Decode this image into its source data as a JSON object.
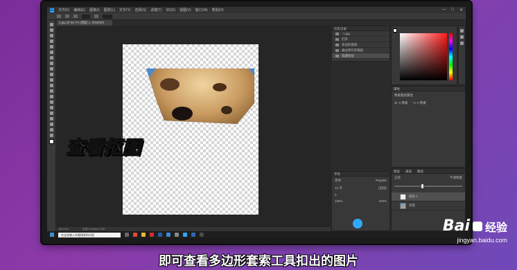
{
  "app": {
    "logo": "Ps",
    "menu": [
      "文件(F)",
      "编辑(E)",
      "图像(I)",
      "图层(L)",
      "文字(Y)",
      "选择(S)",
      "滤镜(T)",
      "3D(D)",
      "视图(V)",
      "窗口(W)",
      "帮助(H)"
    ],
    "window_controls": [
      "—",
      "□",
      "✕"
    ]
  },
  "document": {
    "tab_label": "1.jpg @ 66.7% (图层 1, RGB/8#)",
    "status_zoom": "66.67%",
    "status_info": "文档:1.59M/1.27M"
  },
  "panels": {
    "history": {
      "title": "历史记录",
      "snapshot": "1.jpg",
      "items": [
        "打开",
        "多边形套索",
        "通过拷贝的图层",
        "隐藏图层"
      ],
      "active_index": 3
    },
    "color": {
      "title": "颜色"
    },
    "properties": {
      "title": "属性",
      "row1": "像素图层属性",
      "w": "W: 0 像素",
      "h": "H: 0 像素"
    },
    "character": {
      "title": "字符",
      "font": "黑体",
      "style": "Regular",
      "size": "12 点",
      "leading": "(自动)",
      "tracking": "0",
      "scale1": "100%",
      "scale2": "100%"
    },
    "layers": {
      "title": "图层",
      "tabs": [
        "图层",
        "通道",
        "路径"
      ],
      "mode": "正常",
      "opacity_label": "不透明度",
      "rows": [
        {
          "name": "图层 1",
          "thumb": "checker",
          "active": true
        },
        {
          "name": "背景",
          "thumb": "photo",
          "active": false
        }
      ]
    }
  },
  "taskbar": {
    "search_placeholder": "在这里输入你要搜索的内容",
    "icons": [
      "task-view",
      "chrome",
      "explorer",
      "wps",
      "word",
      "edge",
      "app",
      "photoshop",
      "ps2",
      "app2",
      "app3"
    ]
  },
  "overlay_title": "查看抠图",
  "subtitle": "即可查看多边形套索工具扣出的图片",
  "watermark": {
    "brand": "Bai",
    "brand_cn": "经验",
    "url": "jingyan.baidu.com"
  },
  "colors": {
    "accent": "#31a8ff",
    "bg_purple": "#7a2e9a"
  }
}
